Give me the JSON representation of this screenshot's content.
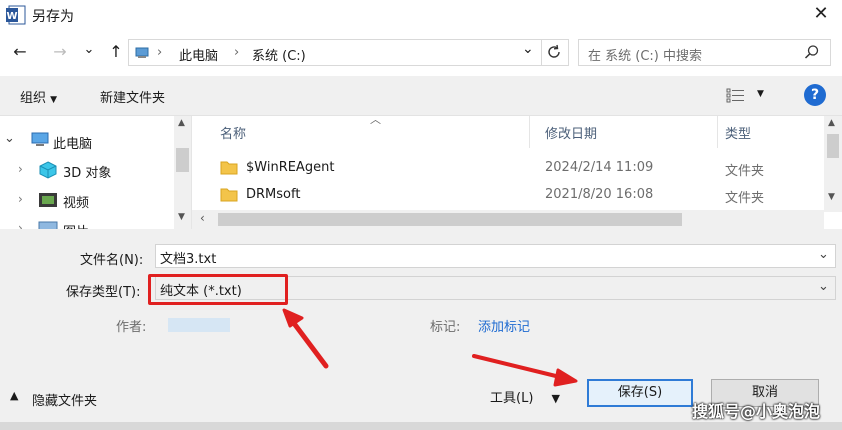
{
  "window": {
    "title": "另存为",
    "close": "✕"
  },
  "nav": {
    "back": "←",
    "forward": "→",
    "recent": "⌄",
    "up": "↑",
    "breadcrumb": [
      "此电脑",
      "系统 (C:)"
    ],
    "chevron": "›",
    "dropdown": "⌄",
    "search_placeholder": "在 系统 (C:) 中搜索"
  },
  "toolbar": {
    "organize": "组织",
    "new_folder": "新建文件夹",
    "help": "?"
  },
  "sidebar": {
    "items": [
      {
        "label": "此电脑",
        "icon": "computer-icon"
      },
      {
        "label": "3D 对象",
        "icon": "3d-objects-icon"
      },
      {
        "label": "视频",
        "icon": "video-icon"
      },
      {
        "label": "图片",
        "icon": "pictures-icon"
      }
    ]
  },
  "files": {
    "columns": [
      "名称",
      "修改日期",
      "类型"
    ],
    "rows": [
      {
        "name": "$WinREAgent",
        "date": "2024/2/14 11:09",
        "type": "文件夹"
      },
      {
        "name": "DRMsoft",
        "date": "2021/8/20 16:08",
        "type": "文件夹"
      }
    ]
  },
  "form": {
    "filename_label": "文件名(N):",
    "filename_value": "文档3.txt",
    "filetype_label": "保存类型(T):",
    "filetype_value": "纯文本 (*.txt)",
    "author_label": "作者:",
    "tags_label": "标记:",
    "tags_link": "添加标记"
  },
  "footer": {
    "hide_folders": "隐藏文件夹",
    "tools": "工具(L)",
    "save": "保存(S)",
    "cancel": "取消"
  },
  "watermark": "搜狐号@小奥泡泡",
  "colors": {
    "accent": "#1f6bd1",
    "annotation": "#e02020",
    "folder": "#f3c44a"
  }
}
